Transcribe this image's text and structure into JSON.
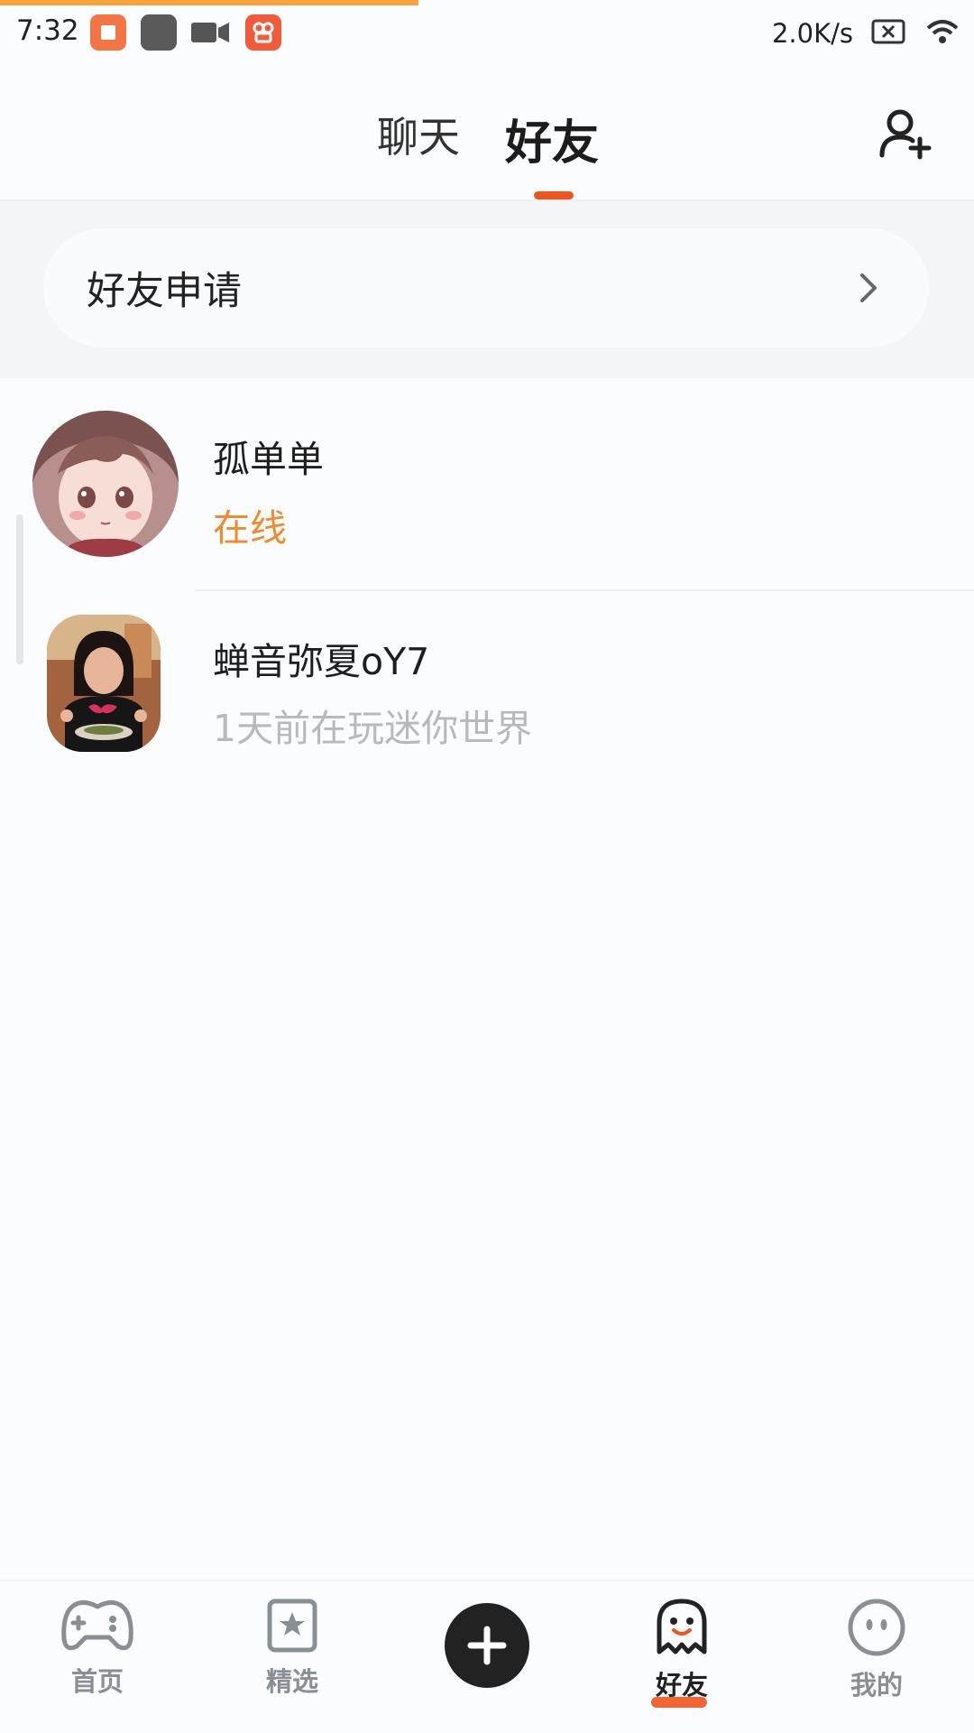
{
  "status_bar": {
    "time": "7:32",
    "net_speed": "2.0K/s"
  },
  "header": {
    "tabs": [
      {
        "label": "聊天",
        "active": false
      },
      {
        "label": "好友",
        "active": true
      }
    ],
    "accent_color": "#f0541d"
  },
  "friend_request": {
    "label": "好友申请"
  },
  "friends": [
    {
      "name": "孤单单",
      "status": "在线",
      "online": true
    },
    {
      "name": "蝉音弥夏oY7",
      "status": "1天前在玩迷你世界",
      "online": false
    }
  ],
  "bottom_nav": {
    "items": [
      {
        "label": "首页",
        "icon": "gamepad-icon"
      },
      {
        "label": "精选",
        "icon": "star-card-icon"
      },
      {
        "label": "",
        "icon": "plus-icon"
      },
      {
        "label": "好友",
        "icon": "ghost-icon",
        "active": true
      },
      {
        "label": "我的",
        "icon": "face-icon"
      }
    ]
  },
  "colors": {
    "online": "#f08a2c",
    "offline": "#b6b9bd",
    "accent": "#f0541d",
    "progress": "#f7a23a"
  }
}
